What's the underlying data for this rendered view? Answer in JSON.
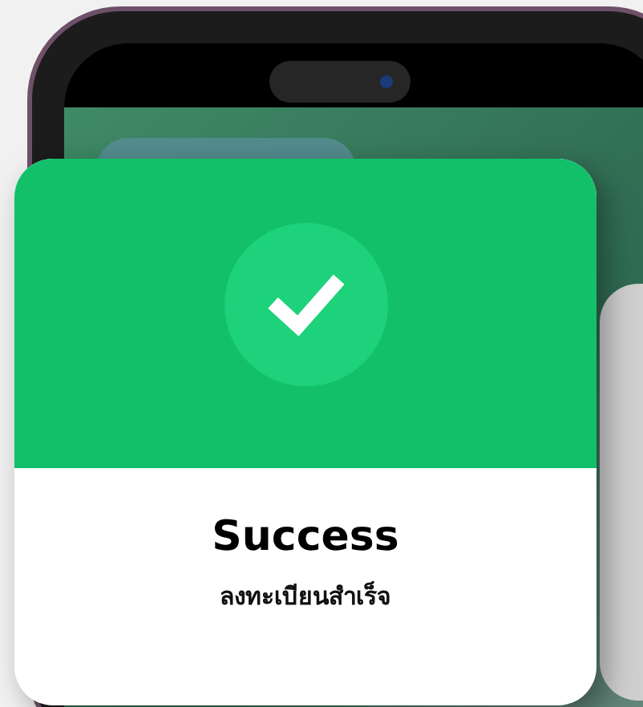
{
  "dialog": {
    "kind": "success",
    "title": "Success",
    "message": "ลงทะเบียนสำเร็จ"
  }
}
